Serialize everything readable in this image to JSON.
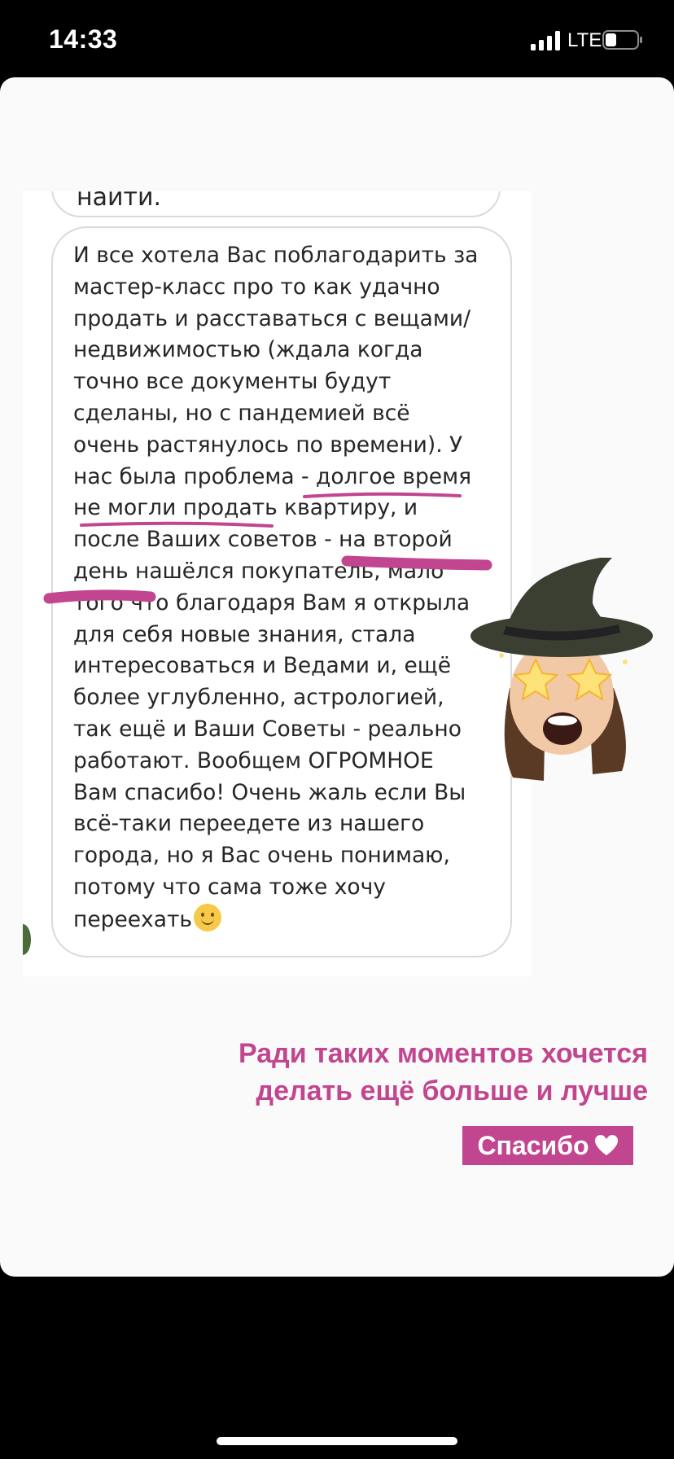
{
  "status_bar": {
    "time": "14:33",
    "network": "LTE",
    "signal_icon": "cellular-signal-icon",
    "battery_icon": "battery-icon",
    "signal_bars_filled": 4
  },
  "chat": {
    "previous_message_tail": "найти.",
    "message_lines": [
      "И все хотела Вас поблагодарить за",
      "мастер-класс про то как удачно",
      "продать и расставаться с вещами/",
      "недвижимостью (ждала когда",
      "точно все документы будут",
      "сделаны, но с пандемией всё",
      "очень растянулось по времени). У",
      "нас была проблема - долгое время",
      "не могли продать квартиру, и",
      "после Ваших советов - на второй",
      "день нашёлся покупатель, мало",
      "того что благодаря Вам я открыла",
      "для себя новые знания, стала",
      "интересоваться и Ведами и, ещё",
      "более углубленно, астрологией,",
      "так ещё и Ваши Советы - реально",
      "работают. Вообщем ОГРОМНОЕ",
      "Вам спасибо! Очень жаль если Вы",
      "всё-таки переедете из нашего",
      "города, но я Вас очень понимаю,",
      "потому что сама тоже хочу",
      "переехать"
    ],
    "smile_emoji": "slightly-smiling-face-icon"
  },
  "sticker": {
    "icon": "witch-memoji-sticker-icon"
  },
  "caption": {
    "line1": "Ради таких моментов  хочется",
    "line2": "делать ещё больше и лучше",
    "badge": "Спасибо",
    "badge_icon": "white-heart-icon"
  },
  "colors": {
    "accent": "#c1468f",
    "background": "#000000",
    "card": "#fafafa",
    "bubble_border": "#dadada",
    "text": "#262626"
  }
}
